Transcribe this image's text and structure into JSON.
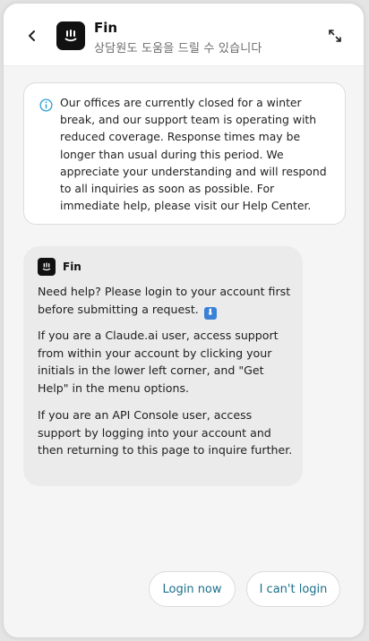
{
  "header": {
    "title": "Fin",
    "subtitle": "상담원도 도움을 드릴 수 있습니다",
    "logo_icon": "intercom-fin-logo",
    "back_icon": "chevron-left-icon",
    "expand_icon": "expand-icon"
  },
  "notice": {
    "icon": "info-icon",
    "text": "Our offices are currently closed for a winter break, and our support team is operating with reduced coverage. Response times may be longer than usual during this period. We appreciate your understanding and will respond to all inquiries as soon as possible. For immediate help, please visit our Help Center."
  },
  "message": {
    "sender": "Fin",
    "paragraph_1": "Need help? Please login to your account first before submitting a request.",
    "paragraph_1_emoji": "⬇",
    "paragraph_2": "If you are a Claude.ai user, access support from within your account by clicking your initials in the lower left corner, and \"Get Help\" in the menu options.",
    "paragraph_3": "If you are an API Console user, access support by logging into your account and then returning to this page to inquire further."
  },
  "quick_replies": {
    "login_now": "Login now",
    "cant_login": "I can't login"
  },
  "colors": {
    "accent": "#1b6f8a",
    "info": "#2a9fd6",
    "bubble_bg": "#ebebeb",
    "panel_bg": "#f5f5f5"
  }
}
